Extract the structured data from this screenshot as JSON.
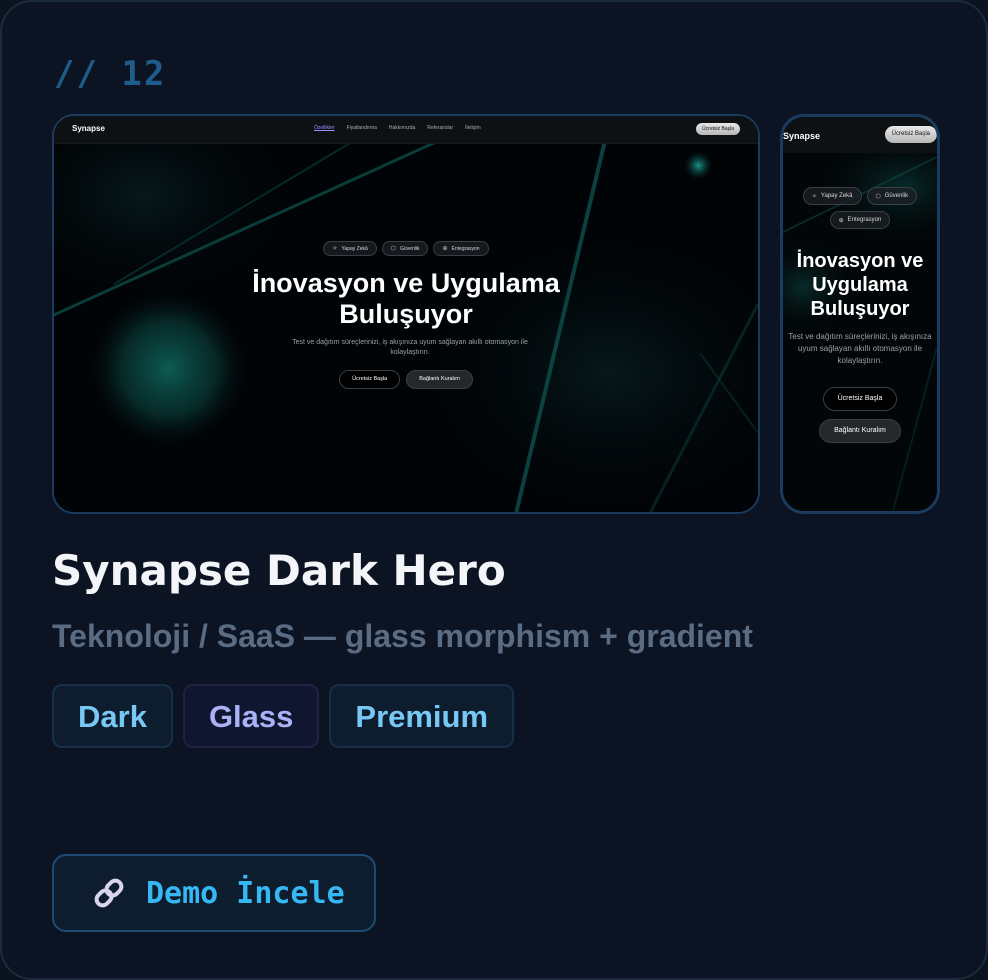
{
  "card": {
    "index": "// 12",
    "title": "Synapse Dark Hero",
    "subtitle": "Teknoloji / SaaS — glass morphism + gradient",
    "tags": [
      "Dark",
      "Glass",
      "Premium"
    ],
    "demo_label": "Demo İncele",
    "demo_icon": "link-icon"
  },
  "desktop_preview": {
    "logo": "Synapse",
    "nav_links": [
      "Özellikler",
      "Fiyatlandırma",
      "Hakkımızda",
      "Referanslar",
      "İletişim"
    ],
    "active_link": "Özellikler",
    "cta": "Ücretsiz Başla",
    "pills": [
      {
        "label": "Yapay Zekâ",
        "icon": "sparkle-icon"
      },
      {
        "label": "Güvenlik",
        "icon": "shield-icon"
      },
      {
        "label": "Entegrasyon",
        "icon": "globe-icon"
      }
    ],
    "title_line1": "İnovasyon ve Uygulama",
    "title_line2": "Buluşuyor",
    "subtitle_line1": "Test ve dağıtım süreçlerinizi, iş akışınıza uyum sağlayan akıllı otomasyon ile",
    "subtitle_line2": "kolaylaştırın.",
    "primary_button": "Ücretsiz Başla",
    "secondary_button": "Bağlantı Kuralım"
  },
  "mobile_preview": {
    "logo": "Synapse",
    "cta": "Ücretsiz Başla",
    "pills": [
      {
        "label": "Yapay Zekâ",
        "icon": "sparkle-icon"
      },
      {
        "label": "Güvenlik",
        "icon": "shield-icon"
      },
      {
        "label": "Entegrasyon",
        "icon": "globe-icon"
      }
    ],
    "title_line1": "İnovasyon ve",
    "title_line2": "Uygulama",
    "title_line3": "Buluşuyor",
    "subtitle_line1": "Test ve dağıtım süreçlerinizi, iş akışınıza",
    "subtitle_line2": "uyum sağlayan akıllı otomasyon ile",
    "subtitle_line3": "kolaylaştırın.",
    "primary_button": "Ücretsiz Başla",
    "secondary_button": "Bağlantı Kuralım"
  },
  "colors": {
    "card_bg": "#0c1322",
    "accent_blue": "#36b8f4",
    "tag_blue": "#77c8f5",
    "tag_violet": "#a9b1f7",
    "teal_glow": "#0f6b62"
  }
}
